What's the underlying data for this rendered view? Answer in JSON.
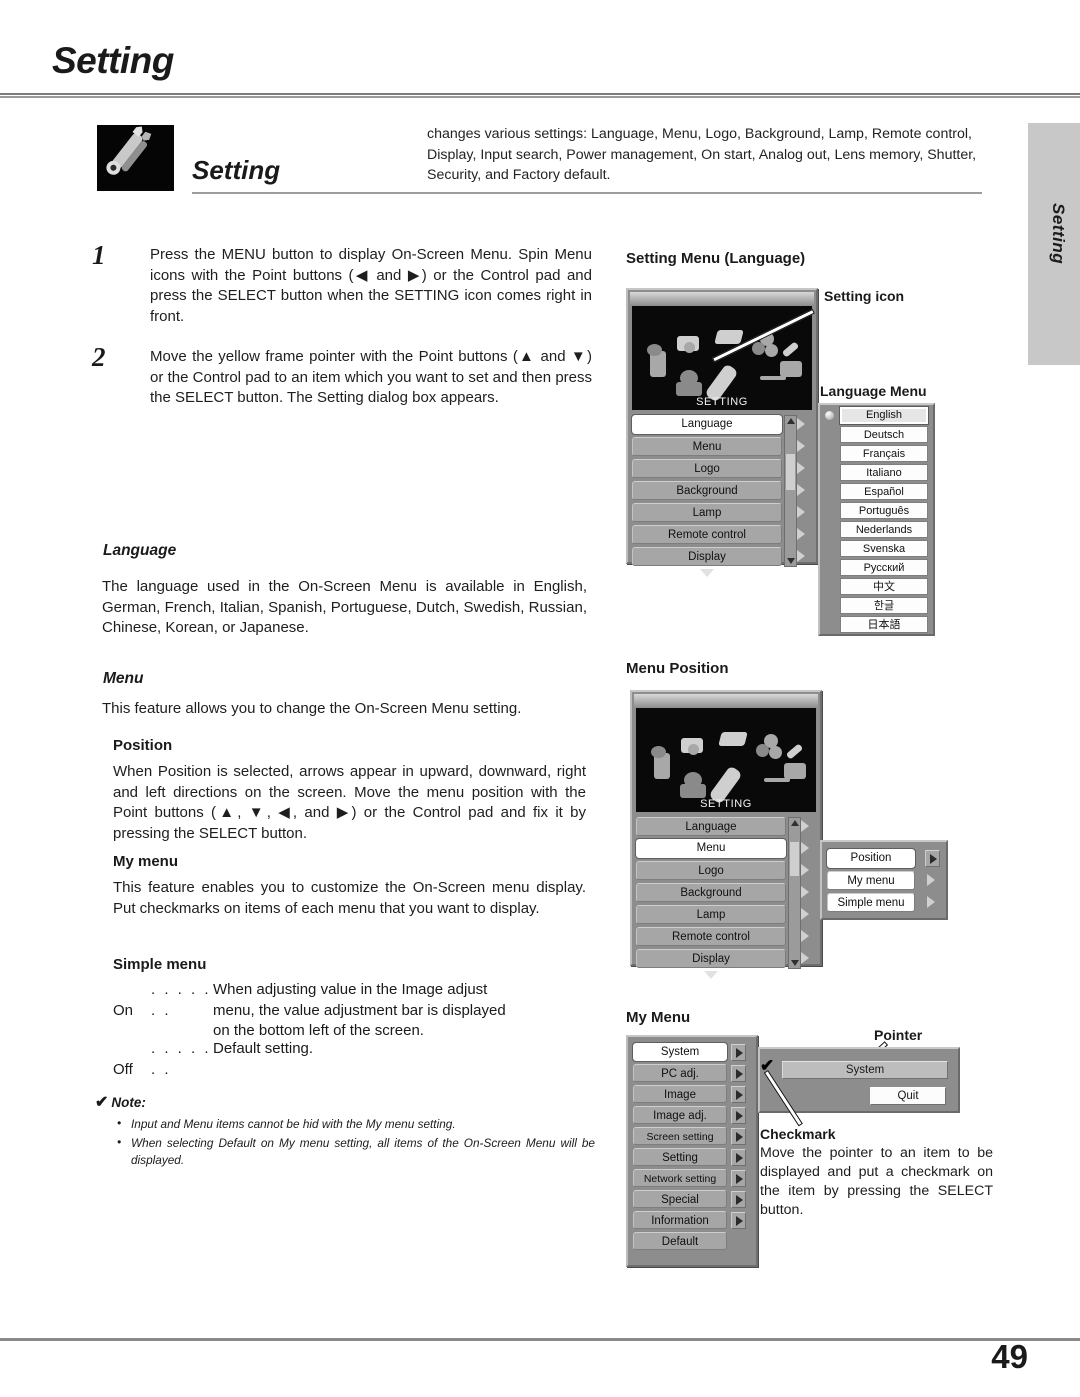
{
  "header": {
    "chapter_title": "Setting",
    "side_tab_label": "Setting"
  },
  "intro": {
    "icon_name": "wrench-screwdriver-icon",
    "title": "Setting",
    "description": "changes various settings: Language, Menu, Logo, Background, Lamp, Remote control, Display, Input search, Power management, On start, Analog out, Lens memory, Shutter, Security, and Factory default."
  },
  "steps": [
    {
      "number": "1",
      "text": "Press the MENU button to display On-Screen Menu. Spin Menu icons with the Point buttons (◀ and ▶) or the Control pad and press the SELECT button when the SETTING icon comes right in front."
    },
    {
      "number": "2",
      "text": "Move the yellow frame pointer with the Point buttons (▲ and ▼) or the Control pad to an item which you want to set and then press the SELECT button. The Setting dialog box appears."
    }
  ],
  "sections": {
    "language": {
      "heading": "Language",
      "body": "The language used in the On-Screen Menu is available in English, German, French, Italian, Spanish, Portuguese, Dutch, Swedish, Russian, Chinese, Korean, or Japanese."
    },
    "menu": {
      "heading": "Menu",
      "body": "This feature allows you to change the On-Screen Menu setting.",
      "position": {
        "heading": "Position",
        "body": "When Position is selected, arrows appear in upward, downward, right and left directions on the screen.  Move the menu position with the Point buttons (▲, ▼, ◀, and ▶) or the Control pad and fix it by pressing the SELECT button."
      },
      "my_menu": {
        "heading": "My menu",
        "body": "This feature enables you to customize the On-Screen menu display.  Put checkmarks on items of each menu that you want to display."
      },
      "simple_menu": {
        "heading": "Simple menu",
        "on_term": "On",
        "on_dots": ". . . . . . .",
        "on_desc": "When adjusting value in the Image adjust menu, the value adjustment bar is displayed on the bottom left of the screen.",
        "off_term": "Off",
        "off_dots": ". . . . . . .",
        "off_desc": "Default setting."
      }
    }
  },
  "note": {
    "heading": "Note:",
    "checkmark_glyph": "✔",
    "items": [
      "Input and Menu items cannot be hid with the My menu setting.",
      "When selecting Default on My menu setting, all items of the On-Screen Menu will be displayed."
    ]
  },
  "figures": {
    "setting_menu_language": {
      "caption": "Setting Menu (Language)",
      "callout_setting_icon": "Setting icon",
      "callout_language_menu": "Language Menu",
      "osd_screen_label": "SETTING",
      "menu_items": [
        "Language",
        "Menu",
        "Logo",
        "Background",
        "Lamp",
        "Remote control",
        "Display"
      ],
      "selected_item": "Language",
      "language_list": [
        "English",
        "Deutsch",
        "Français",
        "Italiano",
        "Español",
        "Português",
        "Nederlands",
        "Svenska",
        "Русский",
        "中文",
        "한글",
        "日本語"
      ],
      "selected_language": "English"
    },
    "menu_position": {
      "caption": "Menu Position",
      "osd_screen_label": "SETTING",
      "menu_items": [
        "Language",
        "Menu",
        "Logo",
        "Background",
        "Lamp",
        "Remote control",
        "Display"
      ],
      "selected_item": "Menu",
      "submenu_items": [
        "Position",
        "My menu",
        "Simple menu"
      ],
      "submenu_selected": "Position"
    },
    "my_menu": {
      "caption": "My Menu",
      "callout_pointer": "Pointer",
      "callout_checkmark": "Checkmark",
      "checkmark_body": "Move the pointer to an item to be displayed and put a checkmark on the item by pressing the SELECT button.",
      "menu_items": [
        "System",
        "PC adj.",
        "Image",
        "Image adj.",
        "Screen setting",
        "Setting",
        "Network setting",
        "Special",
        "Information",
        "Default"
      ],
      "selected_item": "System",
      "dialog_item": "System",
      "dialog_quit": "Quit",
      "checkmark_glyph": "✔"
    }
  },
  "footer": {
    "page_number": "49"
  }
}
